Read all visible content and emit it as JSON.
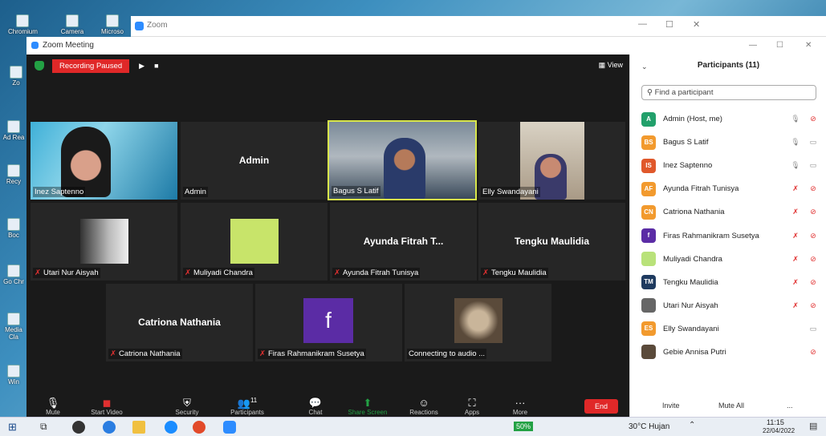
{
  "desktop": {
    "icons": [
      {
        "label": "Chromium"
      },
      {
        "label": "Camera"
      },
      {
        "label": "Microso"
      },
      {
        "label": "Zo"
      },
      {
        "label": "Ad Rea"
      },
      {
        "label": "Recy"
      },
      {
        "label": "Boc"
      },
      {
        "label": "Go Chr"
      },
      {
        "label": "Media Cla"
      },
      {
        "label": "Win"
      }
    ]
  },
  "outer_window": {
    "title": "Zoom",
    "controls": [
      "—",
      "☐",
      "✕"
    ]
  },
  "zoom": {
    "window_title": "Zoom Meeting",
    "recording_label": "Recording Paused",
    "view_label": "View",
    "window_controls": [
      "—",
      "☐",
      "✕"
    ]
  },
  "tiles": [
    {
      "name": "Inez Saptenno",
      "big": "",
      "kind": "video"
    },
    {
      "name": "Admin",
      "big": "Admin",
      "kind": "name"
    },
    {
      "name": "Bagus S Latif",
      "big": "",
      "kind": "video"
    },
    {
      "name": "Elly Swandayani",
      "big": "",
      "kind": "video"
    },
    {
      "name": "Utari Nur Aisyah",
      "big": "",
      "kind": "photo",
      "muted": true
    },
    {
      "name": "Muliyadi Chandra",
      "big": "",
      "kind": "doc",
      "muted": true
    },
    {
      "name": "Ayunda Fitrah Tunisya",
      "big": "Ayunda Fitrah T...",
      "kind": "name",
      "muted": true
    },
    {
      "name": "Tengku Maulidia",
      "big": "Tengku Maulidia",
      "kind": "name",
      "muted": true
    },
    {
      "name": "Catriona Nathania",
      "big": "Catriona Nathania",
      "kind": "name",
      "muted": true
    },
    {
      "name": "Firas Rahmanikram Susetya",
      "big": "f",
      "kind": "letter",
      "muted": true
    },
    {
      "name": "Connecting to audio ...",
      "big": "",
      "kind": "cat"
    }
  ],
  "toolbar": {
    "buttons": [
      "Mute",
      "Start Video",
      "Security",
      "Participants",
      "Chat",
      "Share Screen",
      "Reactions",
      "Apps",
      "More"
    ],
    "participants_count": "11",
    "end": "End"
  },
  "panel": {
    "title": "Participants (11)",
    "search_placeholder": "Find a participant",
    "invite": "Invite",
    "mute_all": "Mute All",
    "more": "...",
    "participants": [
      {
        "initials": "A",
        "name": "Admin (Host, me)",
        "color": "#22a06b"
      },
      {
        "initials": "BS",
        "name": "Bagus S Latif",
        "color": "#f29a2e"
      },
      {
        "initials": "IS",
        "name": "Inez Saptenno",
        "color": "#e0582b"
      },
      {
        "initials": "AF",
        "name": "Ayunda Fitrah Tunisya",
        "color": "#f29a2e"
      },
      {
        "initials": "CN",
        "name": "Catriona Nathania",
        "color": "#f29a2e"
      },
      {
        "initials": "f",
        "name": "Firas Rahmanikram Susetya",
        "color": "#5b2ca5"
      },
      {
        "initials": "",
        "name": "Muliyadi Chandra",
        "color": "#b9e27a"
      },
      {
        "initials": "TM",
        "name": "Tengku Maulidia",
        "color": "#1e3a5f"
      },
      {
        "initials": "",
        "name": "Utari Nur Aisyah",
        "color": "#666666"
      },
      {
        "initials": "ES",
        "name": "Elly Swandayani",
        "color": "#f29a2e"
      },
      {
        "initials": "",
        "name": "Gebie Annisa Putri",
        "color": "#5a4a3a"
      }
    ]
  },
  "taskbar": {
    "battery": "50%",
    "weather": "30°C Hujan",
    "time": "11:15",
    "date": "22/04/2022"
  }
}
